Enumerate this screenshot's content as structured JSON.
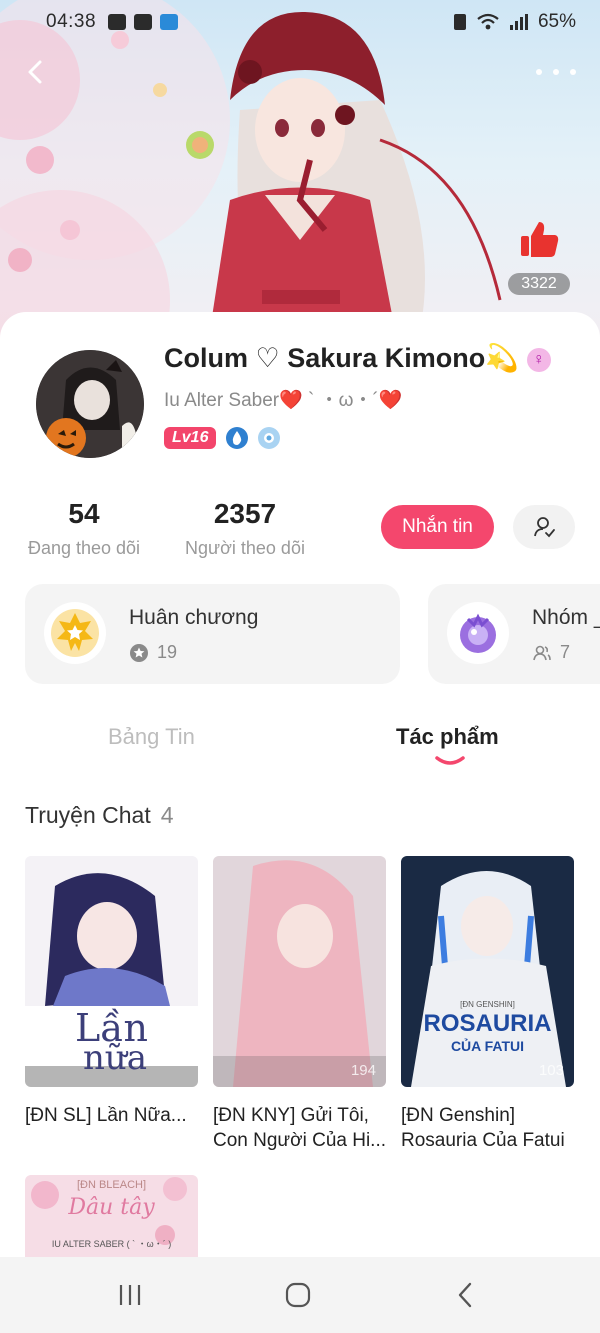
{
  "status_bar": {
    "time": "04:38",
    "battery": "65%"
  },
  "header": {
    "like_count": "3322"
  },
  "profile": {
    "name": "Colum ♡ Sakura Kimono💫",
    "bio": "Iu Alter Saber❤️ ` ・ω・´❤️",
    "level": "Lv16",
    "stats": {
      "following_count": "54",
      "following_label": "Đang theo dõi",
      "followers_count": "2357",
      "followers_label": "Người theo dõi"
    },
    "message_button": "Nhắn tin"
  },
  "medals": {
    "title": "Huân chương",
    "count": "19"
  },
  "groups": {
    "title": "Nhóm _",
    "count": "7"
  },
  "tabs": {
    "feed": "Bảng Tin",
    "works": "Tác phẩm"
  },
  "section": {
    "title": "Truyện Chat",
    "count": "4"
  },
  "stories": [
    {
      "title": "[ĐN SL] Lần Nữa...",
      "cover_text_1": "Lần",
      "cover_text_2": "nữa"
    },
    {
      "title": "[ĐN KNY] Gửi Tôi, Con Người Của Hi...",
      "cover_stat": "194"
    },
    {
      "title": "[ĐN Genshin] Rosauria Của Fatui",
      "cover_tag": "[ĐN GENSHIN]",
      "cover_text_1": "ROSAURIA",
      "cover_text_2": "CỦA FATUI",
      "cover_stat": "103"
    },
    {
      "title": "",
      "cover_tag": "[ĐN BLEACH]",
      "cover_text_1": "Dâu tây",
      "cover_text_2": "IU ALTER SABER ( ` ・ω・´ )"
    }
  ],
  "colors": {
    "accent": "#f4476d",
    "text_primary": "#222222",
    "text_secondary": "#8a8a8a",
    "card_bg": "#f4f4f4"
  }
}
